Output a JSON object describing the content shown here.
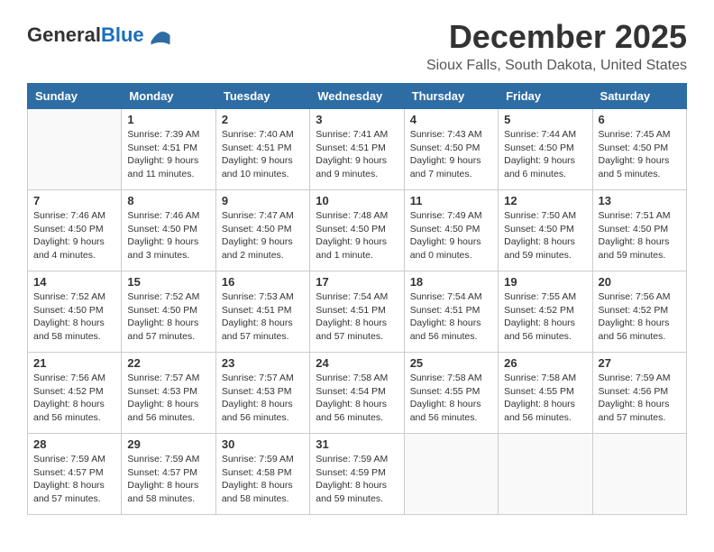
{
  "header": {
    "logo_line1": "General",
    "logo_line2": "Blue",
    "title": "December 2025",
    "subtitle": "Sioux Falls, South Dakota, United States"
  },
  "calendar": {
    "days_of_week": [
      "Sunday",
      "Monday",
      "Tuesday",
      "Wednesday",
      "Thursday",
      "Friday",
      "Saturday"
    ],
    "weeks": [
      [
        {
          "day": "",
          "info": ""
        },
        {
          "day": "1",
          "info": "Sunrise: 7:39 AM\nSunset: 4:51 PM\nDaylight: 9 hours\nand 11 minutes."
        },
        {
          "day": "2",
          "info": "Sunrise: 7:40 AM\nSunset: 4:51 PM\nDaylight: 9 hours\nand 10 minutes."
        },
        {
          "day": "3",
          "info": "Sunrise: 7:41 AM\nSunset: 4:51 PM\nDaylight: 9 hours\nand 9 minutes."
        },
        {
          "day": "4",
          "info": "Sunrise: 7:43 AM\nSunset: 4:50 PM\nDaylight: 9 hours\nand 7 minutes."
        },
        {
          "day": "5",
          "info": "Sunrise: 7:44 AM\nSunset: 4:50 PM\nDaylight: 9 hours\nand 6 minutes."
        },
        {
          "day": "6",
          "info": "Sunrise: 7:45 AM\nSunset: 4:50 PM\nDaylight: 9 hours\nand 5 minutes."
        }
      ],
      [
        {
          "day": "7",
          "info": "Sunrise: 7:46 AM\nSunset: 4:50 PM\nDaylight: 9 hours\nand 4 minutes."
        },
        {
          "day": "8",
          "info": "Sunrise: 7:46 AM\nSunset: 4:50 PM\nDaylight: 9 hours\nand 3 minutes."
        },
        {
          "day": "9",
          "info": "Sunrise: 7:47 AM\nSunset: 4:50 PM\nDaylight: 9 hours\nand 2 minutes."
        },
        {
          "day": "10",
          "info": "Sunrise: 7:48 AM\nSunset: 4:50 PM\nDaylight: 9 hours\nand 1 minute."
        },
        {
          "day": "11",
          "info": "Sunrise: 7:49 AM\nSunset: 4:50 PM\nDaylight: 9 hours\nand 0 minutes."
        },
        {
          "day": "12",
          "info": "Sunrise: 7:50 AM\nSunset: 4:50 PM\nDaylight: 8 hours\nand 59 minutes."
        },
        {
          "day": "13",
          "info": "Sunrise: 7:51 AM\nSunset: 4:50 PM\nDaylight: 8 hours\nand 59 minutes."
        }
      ],
      [
        {
          "day": "14",
          "info": "Sunrise: 7:52 AM\nSunset: 4:50 PM\nDaylight: 8 hours\nand 58 minutes."
        },
        {
          "day": "15",
          "info": "Sunrise: 7:52 AM\nSunset: 4:50 PM\nDaylight: 8 hours\nand 57 minutes."
        },
        {
          "day": "16",
          "info": "Sunrise: 7:53 AM\nSunset: 4:51 PM\nDaylight: 8 hours\nand 57 minutes."
        },
        {
          "day": "17",
          "info": "Sunrise: 7:54 AM\nSunset: 4:51 PM\nDaylight: 8 hours\nand 57 minutes."
        },
        {
          "day": "18",
          "info": "Sunrise: 7:54 AM\nSunset: 4:51 PM\nDaylight: 8 hours\nand 56 minutes."
        },
        {
          "day": "19",
          "info": "Sunrise: 7:55 AM\nSunset: 4:52 PM\nDaylight: 8 hours\nand 56 minutes."
        },
        {
          "day": "20",
          "info": "Sunrise: 7:56 AM\nSunset: 4:52 PM\nDaylight: 8 hours\nand 56 minutes."
        }
      ],
      [
        {
          "day": "21",
          "info": "Sunrise: 7:56 AM\nSunset: 4:52 PM\nDaylight: 8 hours\nand 56 minutes."
        },
        {
          "day": "22",
          "info": "Sunrise: 7:57 AM\nSunset: 4:53 PM\nDaylight: 8 hours\nand 56 minutes."
        },
        {
          "day": "23",
          "info": "Sunrise: 7:57 AM\nSunset: 4:53 PM\nDaylight: 8 hours\nand 56 minutes."
        },
        {
          "day": "24",
          "info": "Sunrise: 7:58 AM\nSunset: 4:54 PM\nDaylight: 8 hours\nand 56 minutes."
        },
        {
          "day": "25",
          "info": "Sunrise: 7:58 AM\nSunset: 4:55 PM\nDaylight: 8 hours\nand 56 minutes."
        },
        {
          "day": "26",
          "info": "Sunrise: 7:58 AM\nSunset: 4:55 PM\nDaylight: 8 hours\nand 56 minutes."
        },
        {
          "day": "27",
          "info": "Sunrise: 7:59 AM\nSunset: 4:56 PM\nDaylight: 8 hours\nand 57 minutes."
        }
      ],
      [
        {
          "day": "28",
          "info": "Sunrise: 7:59 AM\nSunset: 4:57 PM\nDaylight: 8 hours\nand 57 minutes."
        },
        {
          "day": "29",
          "info": "Sunrise: 7:59 AM\nSunset: 4:57 PM\nDaylight: 8 hours\nand 58 minutes."
        },
        {
          "day": "30",
          "info": "Sunrise: 7:59 AM\nSunset: 4:58 PM\nDaylight: 8 hours\nand 58 minutes."
        },
        {
          "day": "31",
          "info": "Sunrise: 7:59 AM\nSunset: 4:59 PM\nDaylight: 8 hours\nand 59 minutes."
        },
        {
          "day": "",
          "info": ""
        },
        {
          "day": "",
          "info": ""
        },
        {
          "day": "",
          "info": ""
        }
      ]
    ]
  }
}
